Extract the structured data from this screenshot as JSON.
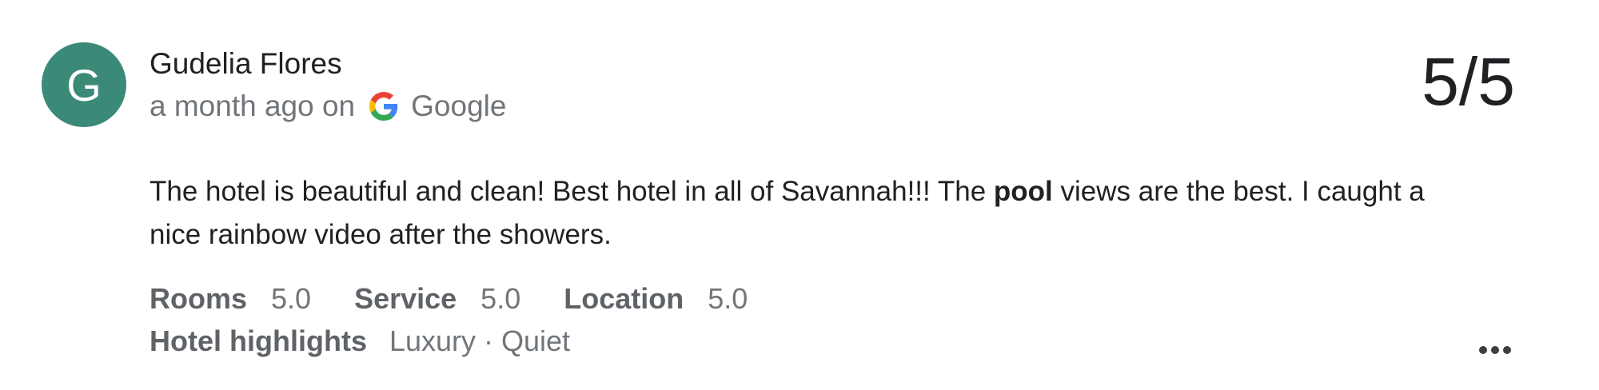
{
  "review": {
    "avatar_initial": "G",
    "author_name": "Gudelia Flores",
    "time_ago": "a month ago on",
    "source": "Google",
    "score": "5/5",
    "text_before": "The hotel is beautiful and clean! Best hotel in all of Savannah!!! The ",
    "text_bold": "pool",
    "text_after": " views are the best. I caught a nice rainbow video after the showers.",
    "ratings": [
      {
        "label": "Rooms",
        "value": "5.0"
      },
      {
        "label": "Service",
        "value": "5.0"
      },
      {
        "label": "Location",
        "value": "5.0"
      }
    ],
    "highlights_label": "Hotel highlights",
    "highlights_value": "Luxury · Quiet",
    "more_icon": "more-horizontal-icon"
  },
  "colors": {
    "avatar_bg": "#3b8a78",
    "text_primary": "#202124",
    "text_secondary": "#70757a",
    "label_bold": "#5f6368"
  }
}
